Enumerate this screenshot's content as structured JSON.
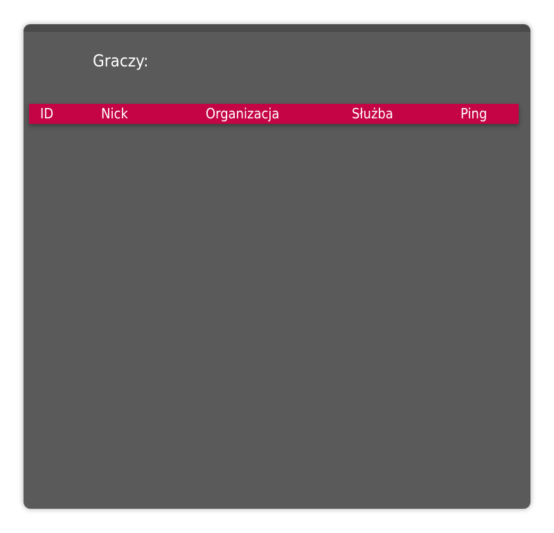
{
  "scoreboard": {
    "title": "Graczy:",
    "columns": {
      "id": "ID",
      "nick": "Nick",
      "organization": "Organizacja",
      "service": "Służba",
      "ping": "Ping"
    },
    "rows": []
  },
  "colors": {
    "panel_background": "#5a5a5a",
    "header_background": "#c40445",
    "text": "#ffffff"
  }
}
